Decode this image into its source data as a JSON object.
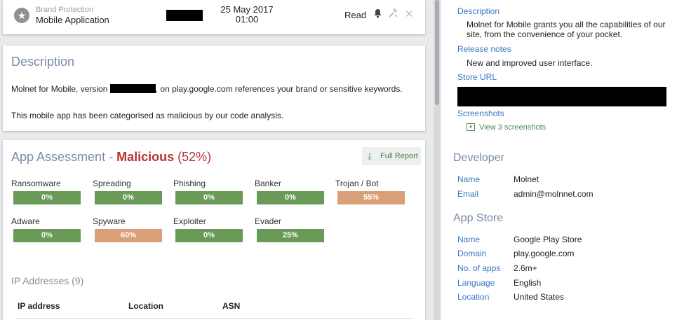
{
  "header": {
    "category": "Brand Protection",
    "subcategory": "Mobile Application",
    "date": "25 May 2017",
    "time": "01:00",
    "status": "Read",
    "icons": [
      "star-icon",
      "bell-icon",
      "hammer-icon",
      "close-icon"
    ]
  },
  "description_card": {
    "title": "Description",
    "text_before": "Molnet for Mobile, version",
    "text_after": ", on play.google.com references your brand or sensitive keywords.",
    "text_malicious": "This mobile app has been categorised as malicious by our code analysis."
  },
  "assessment": {
    "title_prefix": "App Assessment - ",
    "verdict": "Malicious",
    "score": "(52%)",
    "full_report_label": "Full Report",
    "metrics": [
      {
        "label": "Ransomware",
        "value": "0%",
        "level": 0
      },
      {
        "label": "Spreading",
        "value": "0%",
        "level": 0
      },
      {
        "label": "Phishing",
        "value": "0%",
        "level": 0
      },
      {
        "label": "Banker",
        "value": "0%",
        "level": 0
      },
      {
        "label": "Trojan / Bot",
        "value": "55%",
        "level": 55
      },
      {
        "label": "Adware",
        "value": "0%",
        "level": 0
      },
      {
        "label": "Spyware",
        "value": "60%",
        "level": 60
      },
      {
        "label": "Exploiter",
        "value": "0%",
        "level": 0
      },
      {
        "label": "Evader",
        "value": "25%",
        "level": 25
      }
    ],
    "ip_title": "IP Addresses (9)",
    "ip_columns": [
      "IP address",
      "Location",
      "ASN"
    ]
  },
  "details": {
    "description_label": "Description",
    "description_text": "Molnet for Mobile grants you all the capabilities of our site, from the convenience of your pocket.",
    "release_notes_label": "Release notes",
    "release_notes_text": "New and improved user interface.",
    "store_url_label": "Store URL",
    "screenshots_label": "Screenshots",
    "screenshots_link": "View 3 screenshots"
  },
  "developer": {
    "title": "Developer",
    "fields": [
      {
        "key": "Name",
        "value": "Molnet"
      },
      {
        "key": "Email",
        "value": "admin@molnnet.com"
      }
    ]
  },
  "app_store": {
    "title": "App Store",
    "fields": [
      {
        "key": "Name",
        "value": "Google Play Store"
      },
      {
        "key": "Domain",
        "value": "play.google.com"
      },
      {
        "key": "No. of apps",
        "value": "2.6m+"
      },
      {
        "key": "Language",
        "value": "English"
      },
      {
        "key": "Location",
        "value": "United States"
      }
    ]
  },
  "colors": {
    "low_risk": "#6a9a57",
    "elevated_risk": "#d9a078",
    "malicious": "#b93232",
    "link": "#3b77c4",
    "section_title": "#7a8aa8"
  }
}
